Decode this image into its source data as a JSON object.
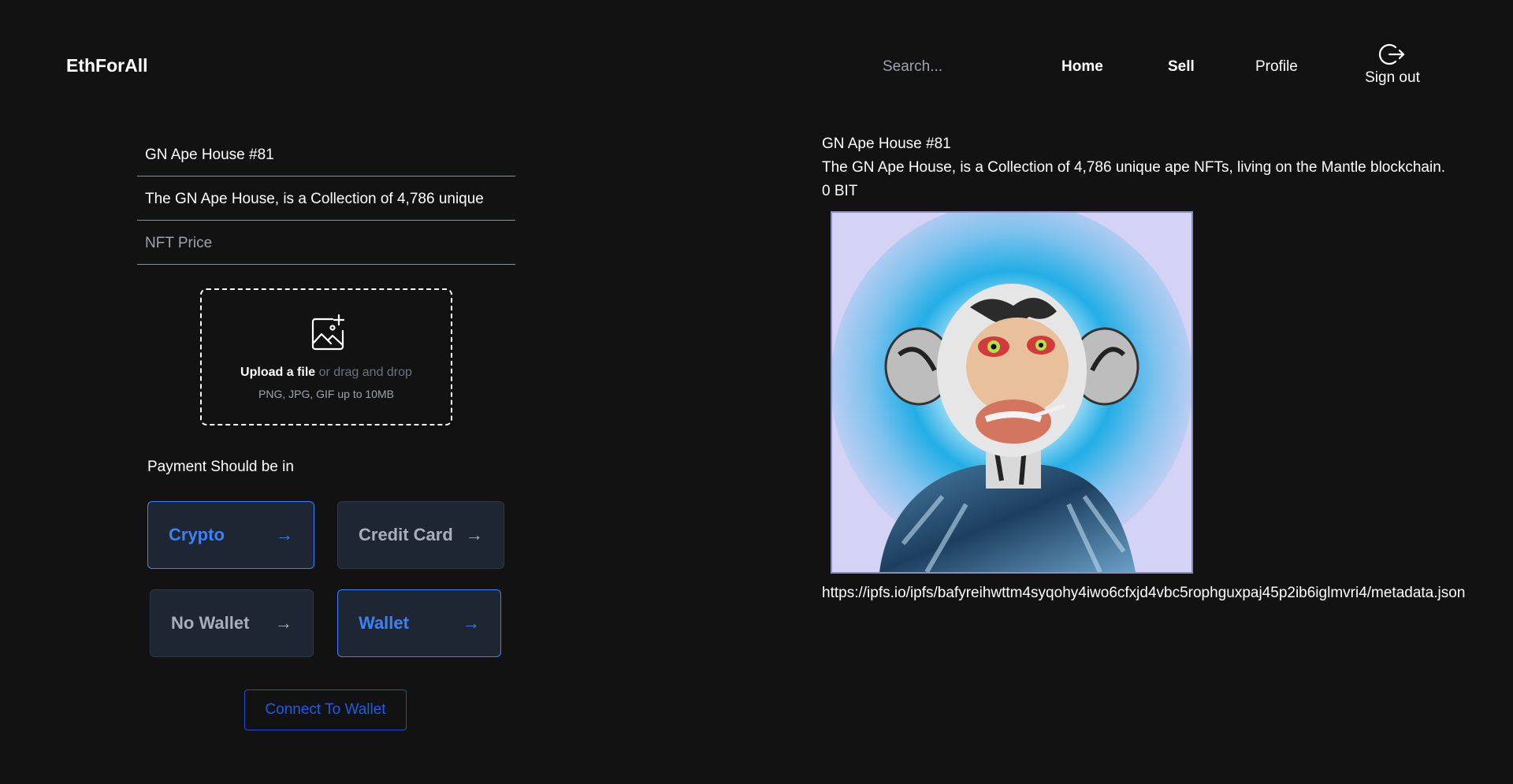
{
  "header": {
    "brand": "EthForAll",
    "search_placeholder": "Search...",
    "nav": {
      "home": "Home",
      "sell": "Sell",
      "profile": "Profile"
    },
    "sign_out": "Sign out"
  },
  "form": {
    "name_value": "GN Ape House #81",
    "description_value": "The GN Ape House, is a Collection of 4,786 unique",
    "price_placeholder": "NFT Price",
    "upload": {
      "link": "Upload a file",
      "rest": "or drag and drop",
      "hint": "PNG, JPG, GIF up to 10MB"
    },
    "payment_label": "Payment Should be in",
    "payment_buttons": [
      {
        "label": "Crypto",
        "active": true
      },
      {
        "label": "Credit Card",
        "active": false
      },
      {
        "label": "No Wallet",
        "active": false
      },
      {
        "label": "Wallet",
        "active": true
      }
    ],
    "connect_button": "Connect To Wallet"
  },
  "preview": {
    "title": "GN Ape House #81",
    "description": "The GN Ape House, is a Collection of 4,786 unique ape NFTs, living on the Mantle blockchain.",
    "price": "0 BIT",
    "metadata_url": "https://ipfs.io/ipfs/bafyreihwttm4syqohy4iwo6cfxjd4vbc5rophguxpaj45p2ib6iglmvri4/metadata.json"
  },
  "colors": {
    "background": "#121212",
    "accent": "#3b82f6",
    "field_underline": "#3fb8a8",
    "button_bg": "#1e2533",
    "connect": "#1d4ed8"
  },
  "icons": [
    "image-add-icon",
    "sign-out-icon",
    "arrow-right-icon"
  ]
}
